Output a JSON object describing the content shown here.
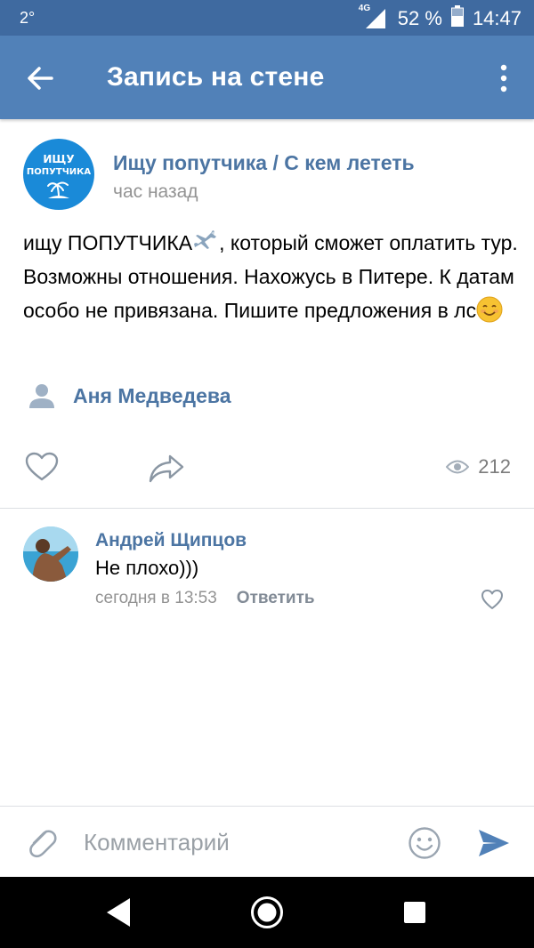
{
  "status_bar": {
    "temperature": "2°",
    "network": "4G",
    "battery": "52 %",
    "time": "14:47"
  },
  "app_bar": {
    "title": "Запись на стене"
  },
  "post": {
    "group_name": "Ищу попутчика / С кем лететь",
    "avatar_line1": "ИЩУ",
    "avatar_line2": "ПОПУТЧИКА",
    "time": "час назад",
    "text_part1": "ищу ПОПУТЧИКА",
    "text_part2": ", который сможет оплатить тур. Возможны отношения. Нахожусь в Питере. К датам особо не привязана. Пишите предложения в лс",
    "author": "Аня Медведева",
    "views": "212"
  },
  "comment": {
    "author": "Андрей Щипцов",
    "text": "Не плохо)))",
    "time": "сегодня в 13:53",
    "reply_label": "Ответить"
  },
  "composer": {
    "placeholder": "Комментарий"
  },
  "colors": {
    "appbar": "#5181b8",
    "statusbar": "#3f6aa0",
    "link": "#4c75a3",
    "muted": "#939393"
  }
}
